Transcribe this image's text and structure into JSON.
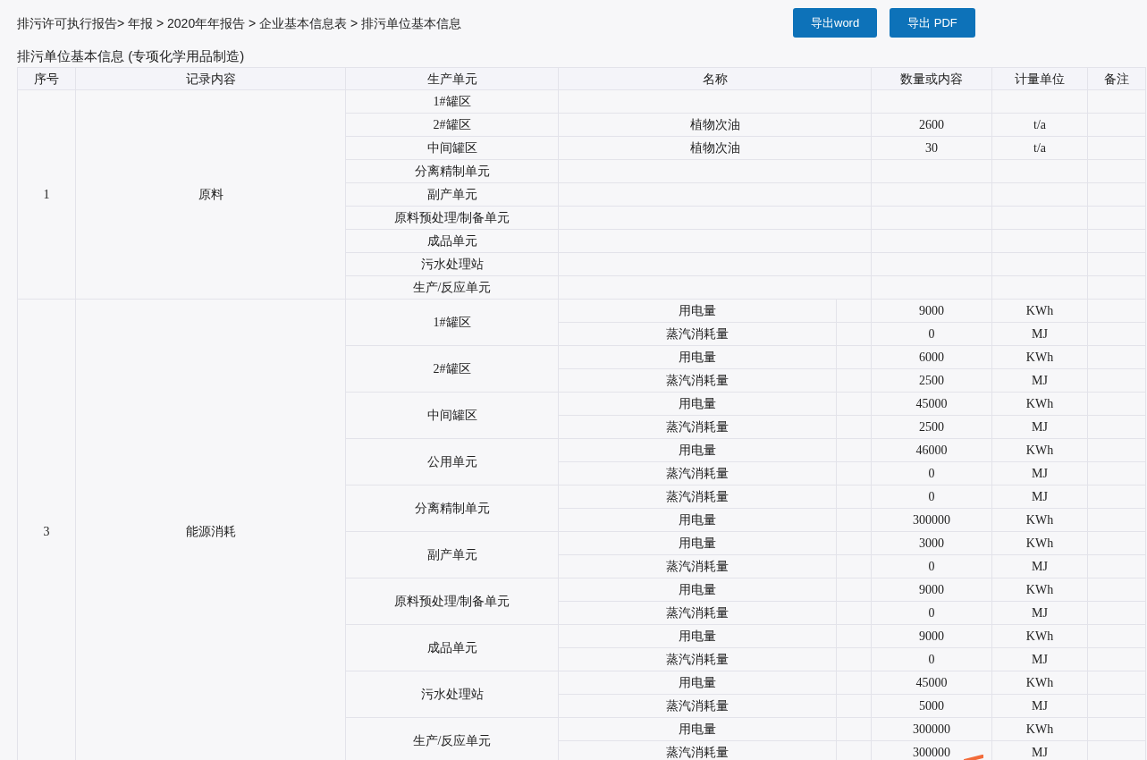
{
  "breadcrumb": "排污许可执行报告> 年报 > 2020年年报告 > 企业基本信息表 > 排污单位基本信息",
  "buttons": [
    "导出word",
    "导出 PDF"
  ],
  "title": "排污单位基本信息 (专项化学用品制造)",
  "table": {
    "columns": [
      "序号",
      "记录内容",
      "生产单元",
      "名称",
      "数量或内容",
      "计量单位",
      "备注"
    ],
    "sections": [
      {
        "kind": "single",
        "index": "1",
        "content": "原料",
        "units": [
          {
            "name": "1#罐区",
            "rows": [
              {}
            ]
          },
          {
            "name": "2#罐区",
            "rows": [
              {
                "name": "植物次油",
                "quantity": "2600",
                "unit": "t/a"
              }
            ]
          },
          {
            "name": "中间罐区",
            "rows": [
              {
                "name": "植物次油",
                "quantity": "30",
                "unit": "t/a"
              }
            ]
          },
          {
            "name": "分离精制单元",
            "rows": [
              {}
            ]
          },
          {
            "name": "副产单元",
            "rows": [
              {}
            ]
          },
          {
            "name": "原料预处理/制备单元",
            "rows": [
              {}
            ]
          },
          {
            "name": "成品单元",
            "rows": [
              {}
            ]
          },
          {
            "name": "污水处理站",
            "rows": [
              {}
            ]
          },
          {
            "name": "生产/反应单元",
            "rows": [
              {}
            ]
          }
        ]
      },
      {
        "kind": "split",
        "index": "3",
        "content": "能源消耗",
        "units": [
          {
            "name": "1#罐区",
            "rows": [
              {
                "name": "用电量",
                "quantity": "9000",
                "unit": "KWh"
              },
              {
                "name": "蒸汽消耗量",
                "quantity": "0",
                "unit": "MJ"
              }
            ]
          },
          {
            "name": "2#罐区",
            "rows": [
              {
                "name": "用电量",
                "quantity": "6000",
                "unit": "KWh"
              },
              {
                "name": "蒸汽消耗量",
                "quantity": "2500",
                "unit": "MJ"
              }
            ]
          },
          {
            "name": "中间罐区",
            "rows": [
              {
                "name": "用电量",
                "quantity": "45000",
                "unit": "KWh"
              },
              {
                "name": "蒸汽消耗量",
                "quantity": "2500",
                "unit": "MJ"
              }
            ]
          },
          {
            "name": "公用单元",
            "rows": [
              {
                "name": "用电量",
                "quantity": "46000",
                "unit": "KWh"
              },
              {
                "name": "蒸汽消耗量",
                "quantity": "0",
                "unit": "MJ"
              }
            ]
          },
          {
            "name": "分离精制单元",
            "rows": [
              {
                "name": "蒸汽消耗量",
                "quantity": "0",
                "unit": "MJ"
              },
              {
                "name": "用电量",
                "quantity": "300000",
                "unit": "KWh"
              }
            ]
          },
          {
            "name": "副产单元",
            "rows": [
              {
                "name": "用电量",
                "quantity": "3000",
                "unit": "KWh"
              },
              {
                "name": "蒸汽消耗量",
                "quantity": "0",
                "unit": "MJ"
              }
            ]
          },
          {
            "name": "原料预处理/制备单元",
            "rows": [
              {
                "name": "用电量",
                "quantity": "9000",
                "unit": "KWh"
              },
              {
                "name": "蒸汽消耗量",
                "quantity": "0",
                "unit": "MJ"
              }
            ]
          },
          {
            "name": "成品单元",
            "rows": [
              {
                "name": "用电量",
                "quantity": "9000",
                "unit": "KWh"
              },
              {
                "name": "蒸汽消耗量",
                "quantity": "0",
                "unit": "MJ"
              }
            ]
          },
          {
            "name": "污水处理站",
            "rows": [
              {
                "name": "用电量",
                "quantity": "45000",
                "unit": "KWh"
              },
              {
                "name": "蒸汽消耗量",
                "quantity": "5000",
                "unit": "MJ"
              }
            ]
          },
          {
            "name": "生产/反应单元",
            "rows": [
              {
                "name": "用电量",
                "quantity": "300000",
                "unit": "KWh"
              },
              {
                "name": "蒸汽消耗量",
                "quantity": "300000",
                "unit": "MJ"
              }
            ]
          }
        ]
      }
    ]
  }
}
